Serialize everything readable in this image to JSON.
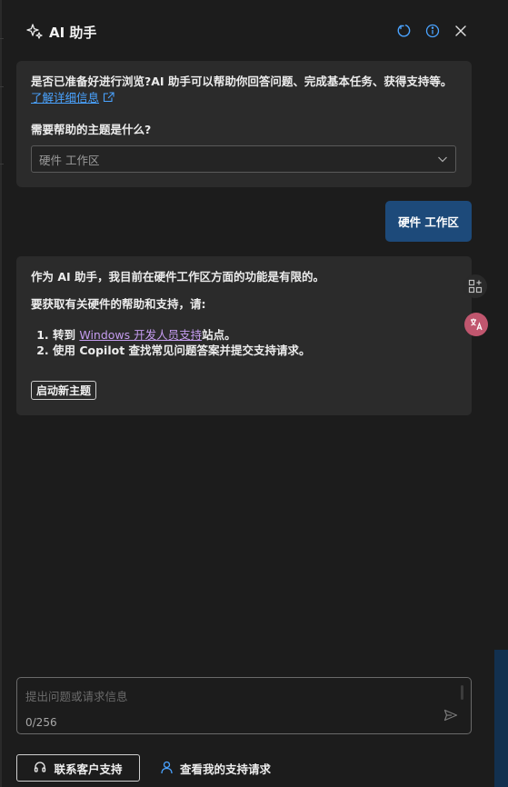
{
  "header": {
    "title": "AI 助手",
    "icons": [
      "sparkle-icon",
      "refresh-icon",
      "info-icon",
      "close-icon"
    ]
  },
  "intro": {
    "text": "是否已准备好进行浏览?AI 助手可以帮助你回答问题、完成基本任务、获得支持等。",
    "learn_more": "了解详细信息",
    "topic_question": "需要帮助的主题是什么?",
    "topic_select": {
      "value": "硬件 工作区"
    }
  },
  "user_message": "硬件 工作区",
  "answer": {
    "line1": "作为 AI 助手，我目前在硬件工作区方面的功能是有限的。",
    "line2": "要获取有关硬件的帮助和支持，请:",
    "step1_prefix": "转到 ",
    "step1_link": "Windows 开发人员支持",
    "step1_suffix": "站点。",
    "step2": "使用 Copilot 查找常见问题答案并提交支持请求。",
    "new_topic_label": "启动新主题"
  },
  "side_icons": [
    "apps-add-icon",
    "translate-icon"
  ],
  "input": {
    "placeholder": "提出问题或请求信息",
    "counter": "0/256"
  },
  "footer": {
    "contact_label": "联系客户支持",
    "view_requests_label": "查看我的支持请求"
  },
  "colors": {
    "background": "#1c1c1c",
    "card": "#2b2b2b",
    "accent": "#1d4a7a",
    "link": "#4aa3ff",
    "visited_link": "#c59cf0",
    "translate_badge": "#c0566e"
  }
}
